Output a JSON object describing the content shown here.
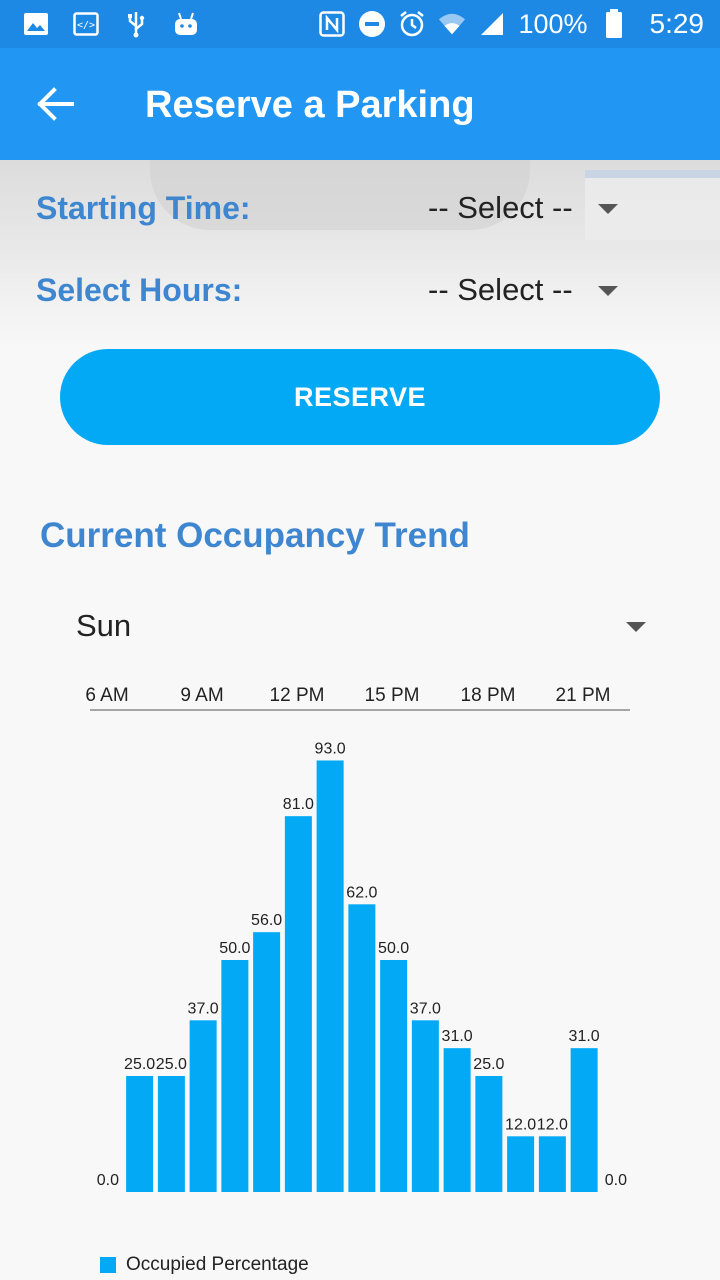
{
  "status_bar": {
    "battery": "100%",
    "time": "5:29"
  },
  "app_bar": {
    "title": "Reserve a Parking",
    "back_icon": "arrow-left-icon"
  },
  "form": {
    "starting_time": {
      "label": "Starting Time:",
      "value": "-- Select --"
    },
    "select_hours": {
      "label": "Select Hours:",
      "value": "-- Select --"
    }
  },
  "reserve_button": {
    "label": "RESERVE"
  },
  "occupancy": {
    "title": "Current Occupancy Trend",
    "day_select": "Sun"
  },
  "colors": {
    "accent": "#03a9f4",
    "header": "#2196f3",
    "label": "#3f86d0"
  },
  "chart_data": {
    "type": "bar",
    "x_axis_position": "top",
    "x_tick_labels": [
      "6 AM",
      "9 AM",
      "12 PM",
      "15 PM",
      "18 PM",
      "21 PM"
    ],
    "values": [
      0.0,
      25.0,
      25.0,
      37.0,
      50.0,
      56.0,
      81.0,
      93.0,
      62.0,
      50.0,
      37.0,
      31.0,
      25.0,
      12.0,
      12.0,
      31.0,
      0.0
    ],
    "value_labels": [
      "0.0",
      "25.0",
      "25.0",
      "37.0",
      "50.0",
      "56.0",
      "81.0",
      "93.0",
      "62.0",
      "50.0",
      "37.0",
      "31.0",
      "25.0",
      "12.0",
      "12.0",
      "31.0",
      "0.0"
    ],
    "series": [
      {
        "name": "Occupied Percentage",
        "color": "#03a9f4"
      }
    ],
    "ylim": [
      0,
      100
    ],
    "grid": false,
    "legend": "bottom-left"
  }
}
